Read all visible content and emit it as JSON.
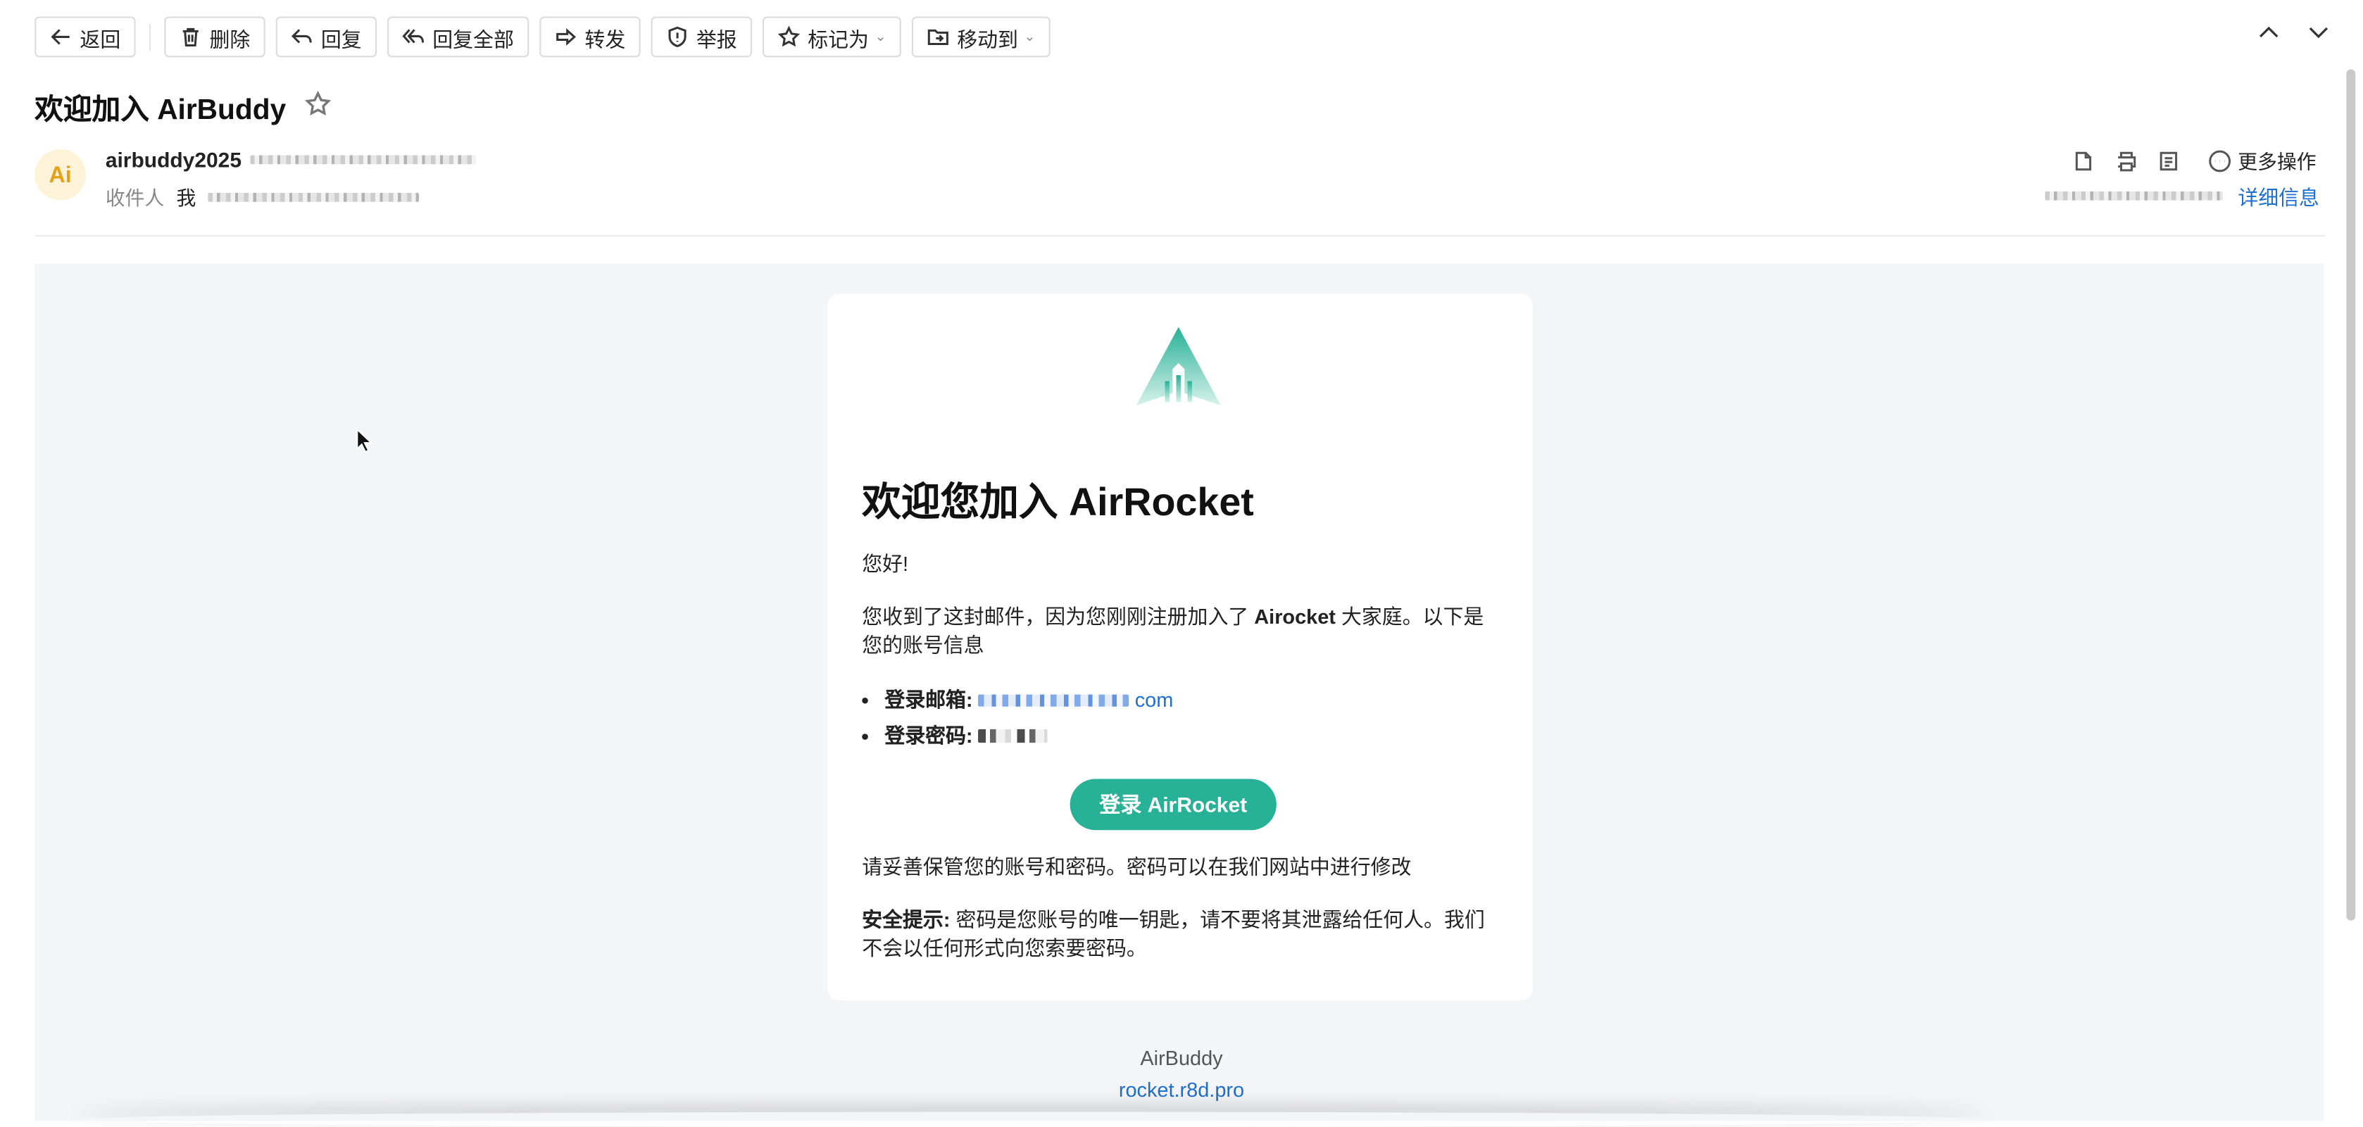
{
  "toolbar": {
    "back": "返回",
    "delete": "删除",
    "reply": "回复",
    "reply_all": "回复全部",
    "forward": "转发",
    "report": "举报",
    "mark_as": "标记为",
    "move_to": "移动到"
  },
  "email": {
    "subject": "欢迎加入 AirBuddy",
    "avatar_initials": "Ai",
    "sender_name": "airbuddy2025",
    "to_label": "收件人",
    "to_me": "我",
    "more_actions": "更多操作",
    "details": "详细信息"
  },
  "body": {
    "heading": "欢迎您加入 AirRocket",
    "greeting": "您好!",
    "info_pre": "您收到了这封邮件，因为您刚刚注册加入了 ",
    "info_brand": "Airocket",
    "info_post": " 大家庭。以下是您的账号信息",
    "login_email_label": "登录邮箱:",
    "login_email_suffix": "com",
    "login_password_label": "登录密码:",
    "cta": "登录 AirRocket",
    "keep_safe": "请妥善保管您的账号和密码。密码可以在我们网站中进行修改",
    "security_label": "安全提示:",
    "security_text": " 密码是您账号的唯一钥匙，请不要将其泄露给任何人。我们不会以任何形式向您索要密码。"
  },
  "footer": {
    "name": "AirBuddy",
    "link": "rocket.r8d.pro"
  },
  "colors": {
    "accent": "#27b197",
    "link": "#1f6fd1",
    "avatar_bg": "#fdf3d8",
    "avatar_fg": "#e5a11a"
  }
}
